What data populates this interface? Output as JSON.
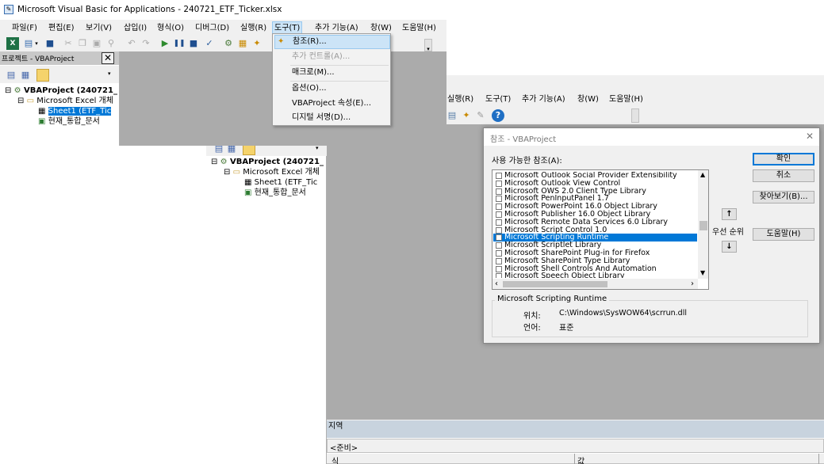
{
  "window": {
    "title": "Microsoft Visual Basic for Applications - 240721_ETF_Ticker.xlsx"
  },
  "menu": [
    {
      "id": "file",
      "label": "파일(F)"
    },
    {
      "id": "edit",
      "label": "편집(E)"
    },
    {
      "id": "view",
      "label": "보기(V)"
    },
    {
      "id": "insert",
      "label": "삽입(I)"
    },
    {
      "id": "format",
      "label": "형식(O)"
    },
    {
      "id": "debug",
      "label": "디버그(D)"
    },
    {
      "id": "run",
      "label": "실행(R)"
    },
    {
      "id": "tools",
      "label": "도구(T)"
    },
    {
      "id": "addins",
      "label": "추가 기능(A)"
    },
    {
      "id": "window",
      "label": "창(W)"
    },
    {
      "id": "help",
      "label": "도움말(H)"
    }
  ],
  "menu2": [
    {
      "id": "run",
      "label": "실행(R)"
    },
    {
      "id": "tools",
      "label": "도구(T)"
    },
    {
      "id": "addins",
      "label": "추가 기능(A)"
    },
    {
      "id": "window",
      "label": "창(W)"
    },
    {
      "id": "help",
      "label": "도움말(H)"
    }
  ],
  "tools_menu": {
    "items": [
      {
        "label": "참조(R)...",
        "highlighted": true,
        "disabled": false
      },
      {
        "label": "추가 컨트롤(A)...",
        "highlighted": false,
        "disabled": true
      },
      {
        "label": "매크로(M)...",
        "highlighted": false,
        "disabled": false
      },
      {
        "label": "옵션(O)...",
        "highlighted": false,
        "disabled": false
      },
      {
        "label": "VBAProject 속성(E)...",
        "highlighted": false,
        "disabled": false
      },
      {
        "label": "디지털 서명(D)...",
        "highlighted": false,
        "disabled": false
      }
    ]
  },
  "project_panel": {
    "title": "프로젝트 - VBAProject",
    "tree": [
      {
        "label": "VBAProject (240721_",
        "bold": true
      },
      {
        "label": "Microsoft Excel 개체",
        "bold": false
      },
      {
        "label": "Sheet1 (ETF_Tic",
        "bold": false,
        "selected": true
      },
      {
        "label": "현재_통합_문서",
        "bold": false
      }
    ],
    "tree2": [
      {
        "label": "VBAProject (240721_",
        "bold": true
      },
      {
        "label": "Microsoft Excel 개체",
        "bold": false
      },
      {
        "label": "Sheet1 (ETF_Tic",
        "bold": false
      },
      {
        "label": "현재_통합_문서",
        "bold": false
      }
    ]
  },
  "references_dialog": {
    "title": "참조 - VBAProject",
    "available_label": "사용 가능한 참조(A):",
    "buttons": {
      "ok": "확인",
      "cancel": "취소",
      "browse": "찾아보기(B)...",
      "help": "도움말(H)"
    },
    "priority_label": "우선 순위",
    "up_arrow": "↑",
    "down_arrow": "↓",
    "references": [
      {
        "name": "Microsoft Outlook Social Provider Extensibility",
        "checked": false,
        "selected": false
      },
      {
        "name": "Microsoft Outlook View Control",
        "checked": false,
        "selected": false
      },
      {
        "name": "Microsoft OWS 2.0 Client Type Library",
        "checked": false,
        "selected": false
      },
      {
        "name": "Microsoft PenInputPanel 1.7",
        "checked": false,
        "selected": false
      },
      {
        "name": "Microsoft PowerPoint 16.0 Object Library",
        "checked": false,
        "selected": false
      },
      {
        "name": "Microsoft Publisher 16.0 Object Library",
        "checked": false,
        "selected": false
      },
      {
        "name": "Microsoft Remote Data Services 6.0 Library",
        "checked": false,
        "selected": false
      },
      {
        "name": "Microsoft Script Control 1.0",
        "checked": false,
        "selected": false
      },
      {
        "name": "Microsoft Scripting Runtime",
        "checked": false,
        "selected": true
      },
      {
        "name": "Microsoft Scriptlet Library",
        "checked": false,
        "selected": false
      },
      {
        "name": "Microsoft SharePoint Plug-in for Firefox",
        "checked": false,
        "selected": false
      },
      {
        "name": "Microsoft SharePoint Type Library",
        "checked": false,
        "selected": false
      },
      {
        "name": "Microsoft Shell Controls And Automation",
        "checked": false,
        "selected": false
      },
      {
        "name": "Microsoft Speech Object Library",
        "checked": false,
        "selected": false
      }
    ],
    "details": {
      "group_title": "Microsoft Scripting Runtime",
      "location_label": "위치:",
      "location_value": "C:\\Windows\\SysWOW64\\scrrun.dll",
      "language_label": "언어:",
      "language_value": "표준"
    }
  },
  "locals": {
    "title": "지역",
    "status": "<준비>",
    "col_expression": "식",
    "col_value": "값"
  },
  "colors": {
    "selection": "#0078d7",
    "menu_highlight": "#cce4f7",
    "mdi_bg": "#ababab",
    "panel_title": "#c8c8c8"
  }
}
